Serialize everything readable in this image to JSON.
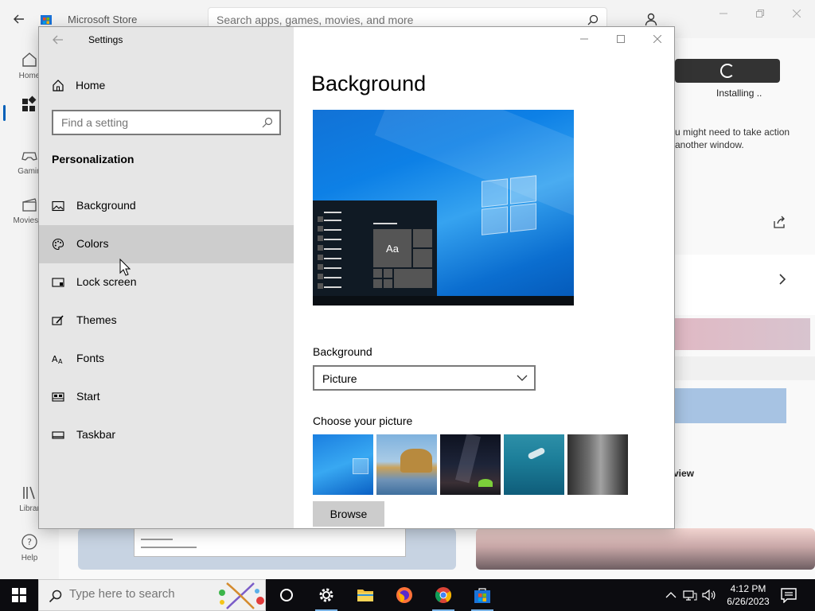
{
  "store": {
    "title": "Microsoft Store",
    "search_placeholder": "Search apps, games, movies, and more",
    "nav": [
      {
        "label": "Home"
      },
      {
        "label": ""
      },
      {
        "label": "Gamin"
      },
      {
        "label": "Movies &"
      },
      {
        "label": "Librar"
      },
      {
        "label": "Help"
      }
    ],
    "install_status": "Installing ..",
    "install_note_1": "u might need to take action",
    "install_note_2": "another window.",
    "review_text": "view"
  },
  "settings": {
    "title": "Settings",
    "home_label": "Home",
    "search_placeholder": "Find a setting",
    "section": "Personalization",
    "menu": [
      {
        "label": "Background",
        "icon": "picture-icon"
      },
      {
        "label": "Colors",
        "icon": "palette-icon"
      },
      {
        "label": "Lock screen",
        "icon": "lock-screen-icon"
      },
      {
        "label": "Themes",
        "icon": "themes-icon"
      },
      {
        "label": "Fonts",
        "icon": "fonts-icon"
      },
      {
        "label": "Start",
        "icon": "start-icon"
      },
      {
        "label": "Taskbar",
        "icon": "taskbar-icon"
      }
    ],
    "hovered_item": "Colors",
    "page_title": "Background",
    "preview_tile_text": "Aa",
    "background_label": "Background",
    "background_value": "Picture",
    "choose_label": "Choose your picture",
    "browse_label": "Browse"
  },
  "taskbar": {
    "search_placeholder": "Type here to search",
    "pinned": [
      "cortana-icon",
      "settings-icon",
      "file-explorer-icon",
      "firefox-icon",
      "chrome-icon",
      "store-icon"
    ],
    "time": "4:12 PM",
    "date": "6/26/2023"
  },
  "colors": {
    "accent": "#005fb8",
    "taskbar": "#0c0c10",
    "settings_nav": "#e6e6e6",
    "hover": "#cdcdcd"
  }
}
